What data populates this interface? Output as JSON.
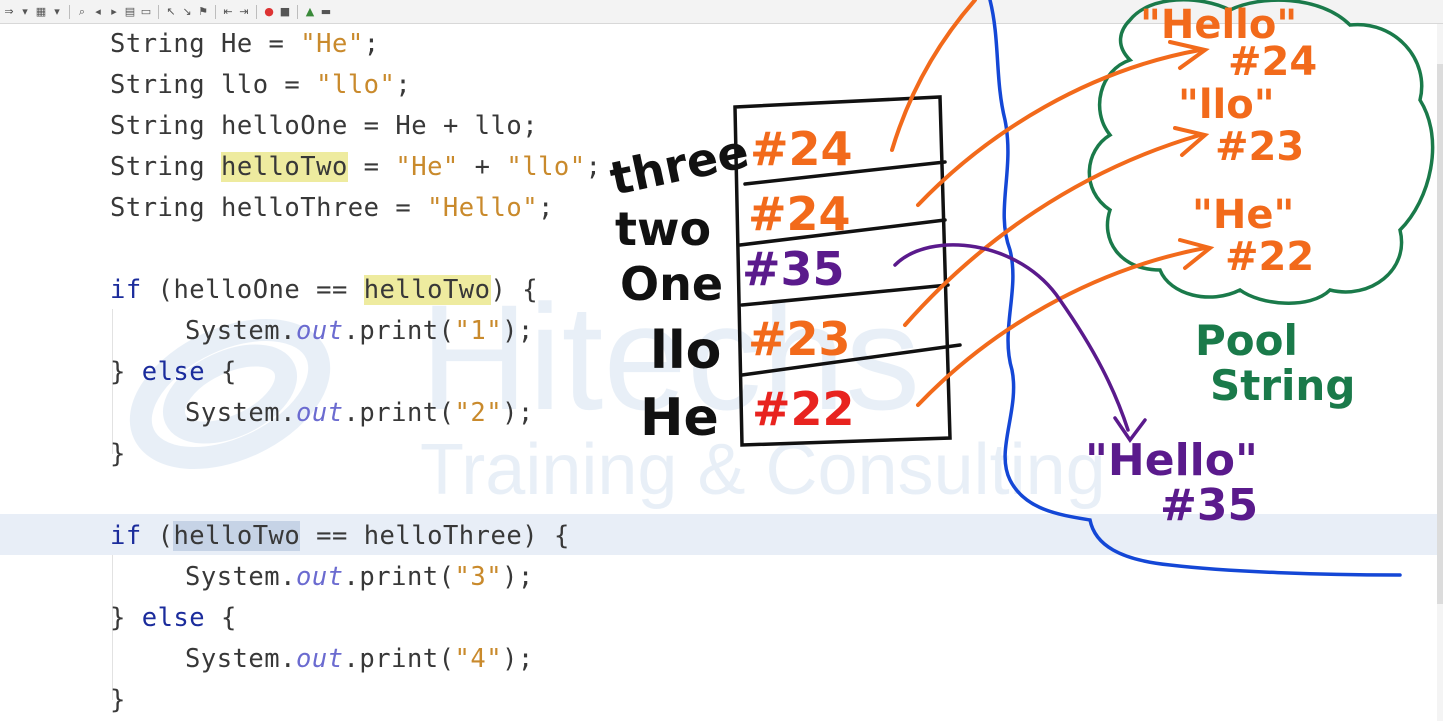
{
  "toolbar": {
    "icons": [
      "skip-icon",
      "dropdown-icon",
      "debug-icon",
      "dropdown-icon",
      "find-icon",
      "find-prev-icon",
      "find-next-icon",
      "toggle-highlight-icon",
      "toggle-rect-icon",
      "prev-bookmark-icon",
      "next-bookmark-icon",
      "toggle-bookmark-icon",
      "shift-left-icon",
      "shift-right-icon",
      "record-macro-icon",
      "stop-macro-icon",
      "run-macro-icon",
      "comment-icon"
    ]
  },
  "code": {
    "lines": [
      "String He = \"He\";",
      "String llo = \"llo\";",
      "String helloOne = He + llo;",
      "String helloTwo = \"He\" + \"llo\";",
      "String helloThree = \"Hello\";",
      "",
      "if (helloOne == helloTwo) {",
      "    System.out.print(\"1\");",
      "} else {",
      "    System.out.print(\"2\");",
      "}",
      "",
      "if (helloTwo == helloThree) {",
      "    System.out.print(\"3\");",
      "} else {",
      "    System.out.print(\"4\");",
      "}"
    ],
    "tokens": {
      "string": "String",
      "if": "if",
      "else": "else",
      "system": "System.",
      "out": "out",
      "print": ".print(",
      "close": ");",
      "open_brace": "{",
      "close_brace": "}",
      "v_He": "He",
      "v_llo": "llo",
      "v_helloOne": "helloOne",
      "v_helloTwo": "helloTwo",
      "v_helloThree": "helloThree",
      "s_He": "\"He\"",
      "s_llo": "\"llo\"",
      "s_Hello": "\"Hello\"",
      "s_1": "\"1\"",
      "s_2": "\"2\"",
      "s_3": "\"3\"",
      "s_4": "\"4\"",
      "eq": " = ",
      "plus": " + ",
      "eqeq": " == ",
      "semi": ";",
      "paren_open": "(",
      "paren_close": ")"
    }
  },
  "watermark": {
    "brand": "Hitechs",
    "tagline": "Training & Consulting"
  },
  "annotations": {
    "stack_labels": [
      "three",
      "two",
      "One",
      "llo",
      "He"
    ],
    "stack_refs": [
      "#24",
      "#24",
      "#35",
      "#23",
      "#22"
    ],
    "pool_entries": [
      {
        "literal": "\"Hello\"",
        "ref": "#24"
      },
      {
        "literal": "\"llo\"",
        "ref": "#23"
      },
      {
        "literal": "\"He\"",
        "ref": "#22"
      }
    ],
    "heap_entry": {
      "literal": "\"Hello\"",
      "ref": "#35"
    },
    "pool_title": [
      "Pool",
      "String"
    ]
  },
  "colors": {
    "keyword": "#1b2c9c",
    "string_literal": "#c98a2c",
    "orange_ink": "#f26a1b",
    "purple_ink": "#5a1a8c",
    "green_ink": "#1a7a4a",
    "blue_ink": "#1447d6",
    "red_ink": "#e8231f",
    "black_ink": "#111111"
  }
}
